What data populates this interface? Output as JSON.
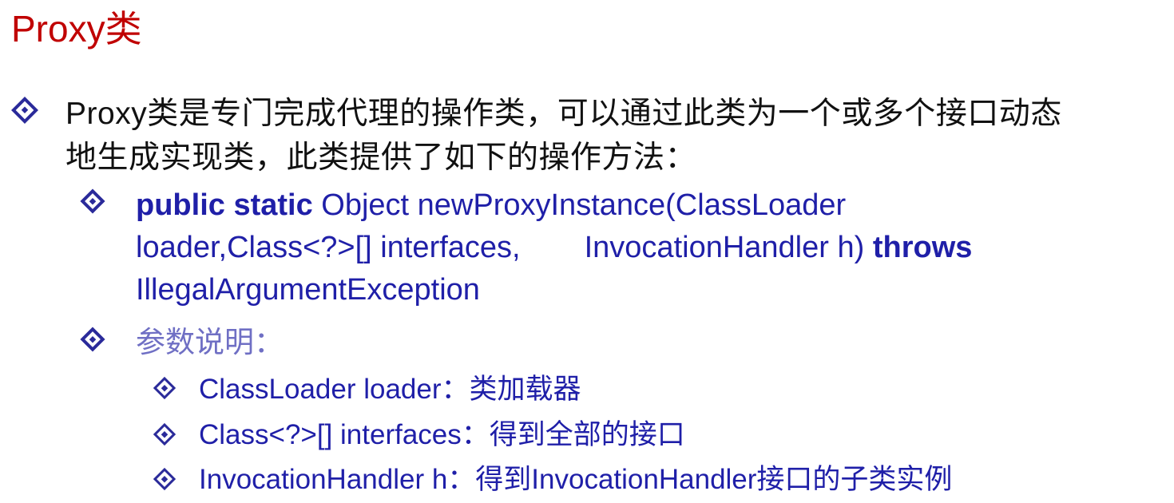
{
  "title": "Proxy类",
  "bullet1": {
    "line1": "Proxy类是专门完成代理的操作类，可以通过此类为一个或多个接口动态",
    "line2": "地生成实现类，此类提供了如下的操作方法："
  },
  "method": {
    "kw_public_static": "public static",
    "sig_part1": " Object newProxyInstance(ClassLoader",
    "sig_part2a": "loader,Class<?>[] interfaces,",
    "sig_part2b": "InvocationHandler h) ",
    "kw_throws": "throws",
    "sig_part3": "IllegalArgumentException"
  },
  "params": {
    "heading": "参数说明：",
    "items": [
      "ClassLoader loader：类加载器",
      "Class<?>[] interfaces：得到全部的接口",
      "InvocationHandler h：得到InvocationHandler接口的子类实例"
    ]
  },
  "colors": {
    "title": "#c00000",
    "body_text": "#111111",
    "code_blue": "#1f1fa8",
    "heading_light_blue": "#6f6fc4",
    "bullet": "#2a2a9a"
  },
  "icons": [
    "diamond-bullet-icon"
  ]
}
